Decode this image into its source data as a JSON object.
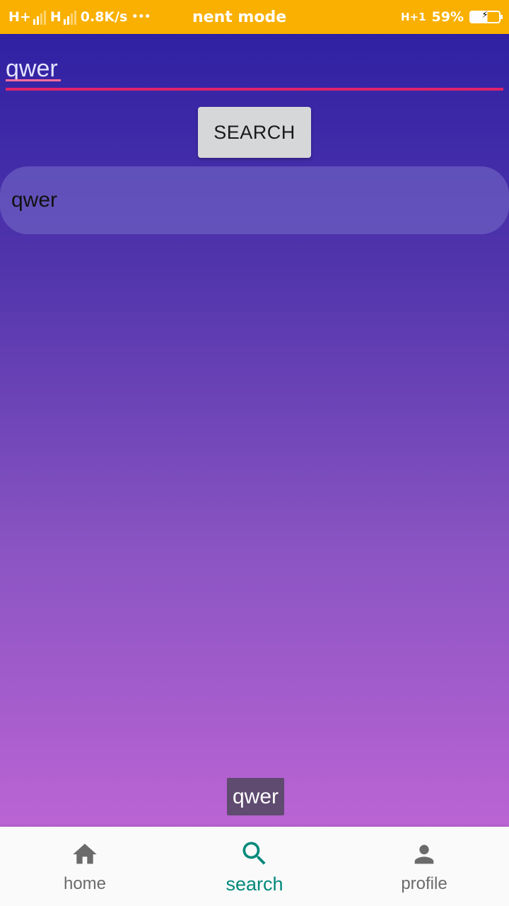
{
  "status_bar": {
    "net1": "H+",
    "net2": "H",
    "speed": "0.8K/s",
    "more": "•••",
    "title": "nent mode",
    "net_right": "H+1",
    "battery": "59%"
  },
  "search": {
    "input_value": "qwer",
    "button_label": "SEARCH"
  },
  "results": [
    {
      "text": "qwer"
    }
  ],
  "toast": {
    "text": "qwer"
  },
  "nav": {
    "items": [
      {
        "label": "home",
        "icon": "home-icon",
        "active": false
      },
      {
        "label": "search",
        "icon": "search-icon",
        "active": true
      },
      {
        "label": "profile",
        "icon": "person-icon",
        "active": false
      }
    ]
  },
  "colors": {
    "status_bar": "#f9b000",
    "accent": "#e0226a",
    "nav_active": "#00897b",
    "nav_inactive": "#6b6b6b",
    "gradient_top": "#2f21a3",
    "gradient_bottom": "#bb64d4"
  }
}
